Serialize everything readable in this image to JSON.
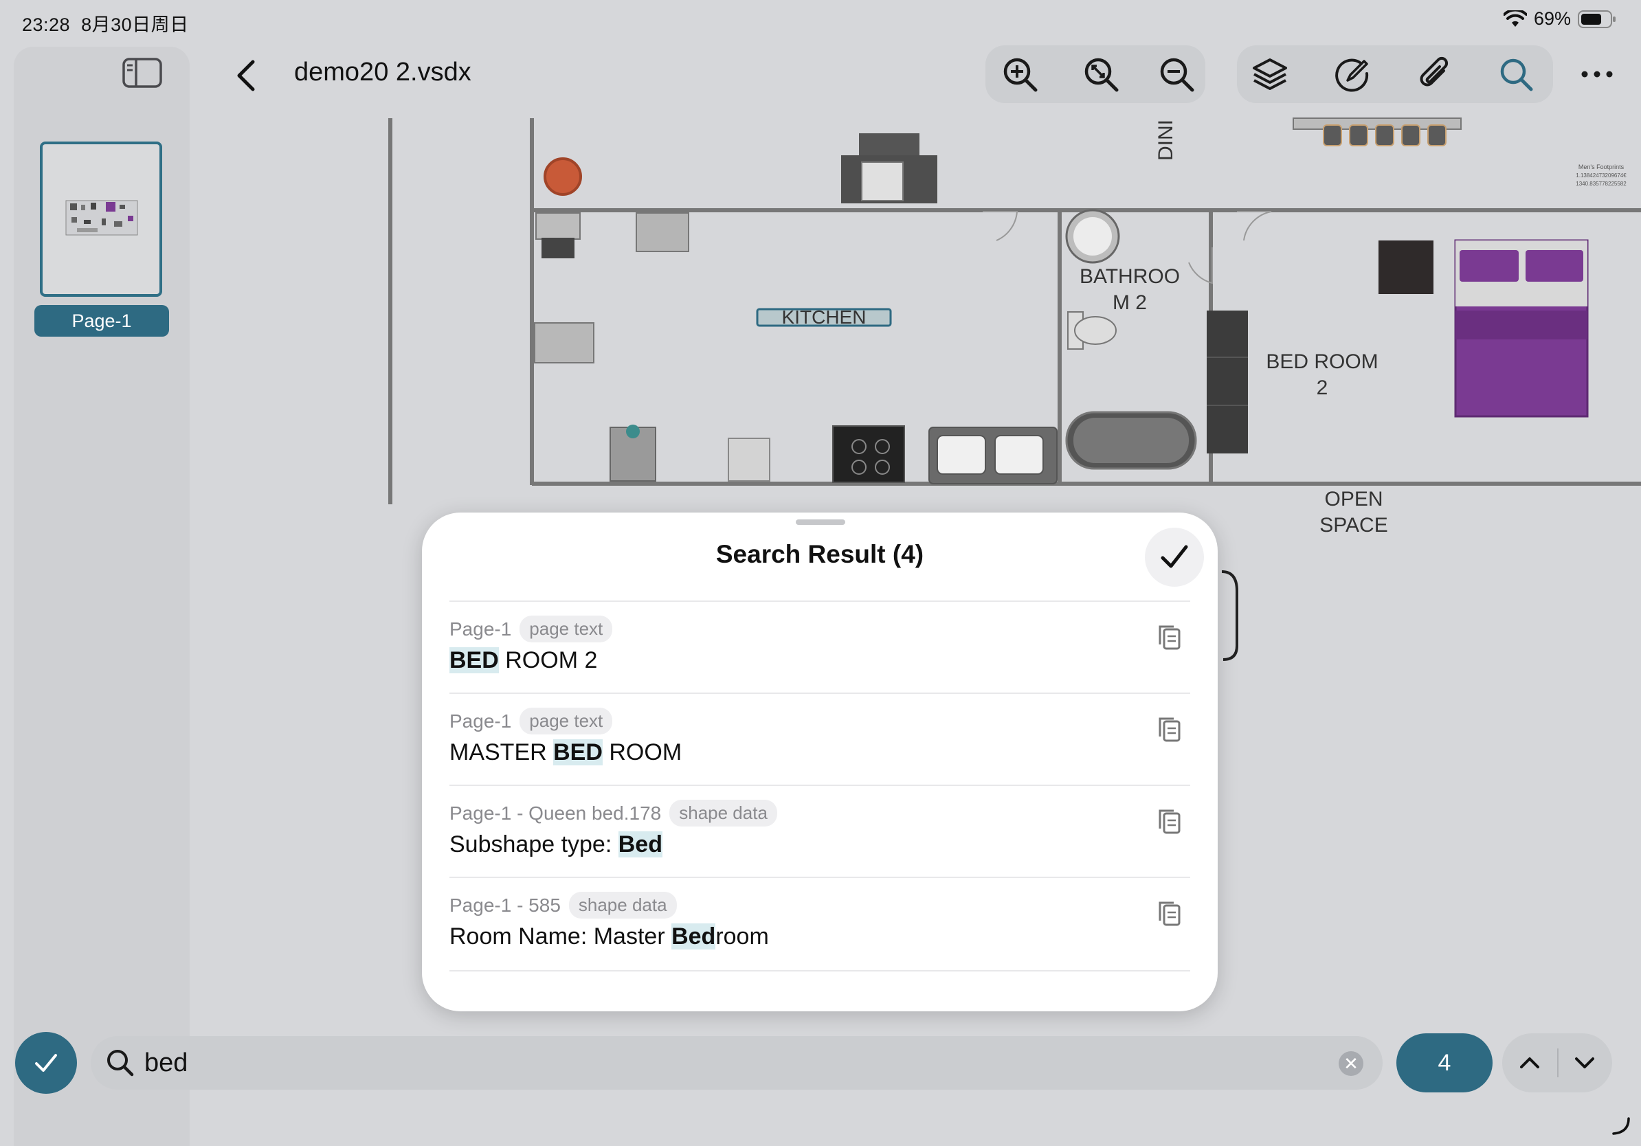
{
  "status": {
    "time": "23:28",
    "date": "8月30日周日",
    "battery": "69%"
  },
  "sidebar": {
    "pages": [
      {
        "label": "Page-1"
      }
    ]
  },
  "header": {
    "title": "demo20 2.vsdx"
  },
  "toolbar": {
    "icons": [
      "zoom-in-icon",
      "zoom-fit-icon",
      "zoom-out-icon",
      "layers-icon",
      "markup-icon",
      "attachment-icon",
      "search-icon",
      "more-icon"
    ]
  },
  "plan": {
    "labels": {
      "kitchen": "KITCHEN",
      "bathroom_1": "BATHROO",
      "bathroom_2": "M 2",
      "bedroom_1": "BED ROOM",
      "bedroom_2": "2",
      "open_1": "OPEN",
      "open_2": "SPACE",
      "dining": "DINI"
    },
    "footprint": [
      "Men's Footprints",
      "1.13842473209674€",
      "1340.835778225582"
    ]
  },
  "sheet": {
    "title": "Search Result (4)",
    "results": [
      {
        "source": "Page-1",
        "type": "page text",
        "pre": "",
        "match": "BED",
        "post": " ROOM 2"
      },
      {
        "source": "Page-1",
        "type": "page text",
        "pre": "MASTER ",
        "match": "BED",
        "post": " ROOM"
      },
      {
        "source": "Page-1 - Queen bed.178",
        "type": "shape data",
        "pre": "Subshape type: ",
        "match": "Bed",
        "post": ""
      },
      {
        "source": "Page-1 - 585",
        "type": "shape data",
        "pre": "Room Name: Master ",
        "match": "Bed",
        "post": "room"
      }
    ]
  },
  "search": {
    "query": "bed",
    "match_count": "4"
  },
  "colors": {
    "accent": "#2e6a82",
    "highlight": "#d8ebef",
    "purple_bed": "#7a3a92"
  }
}
